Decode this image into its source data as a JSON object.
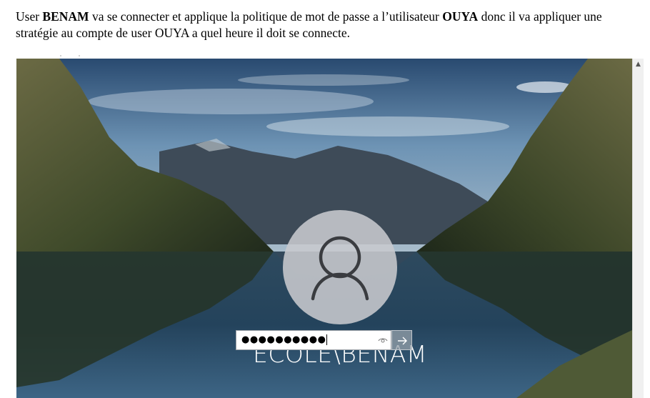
{
  "document": {
    "prefix": "User ",
    "user1": "BENAM",
    "middle": " va se connecter et applique la politique de mot de passe a l’utilisateur ",
    "user2": "OUYA",
    "suffix": " donc il va appliquer une stratégie au compte de user OUYA a quel heure il doit se connecte."
  },
  "login": {
    "username": "ECOLE\\BENAM",
    "password_value": "●●●●●●●●●●",
    "avatar_icon": "user-icon",
    "reveal_icon": "eye-icon",
    "submit_icon": "arrow-right-icon"
  },
  "scrollbar": {
    "up_glyph": "▲"
  }
}
